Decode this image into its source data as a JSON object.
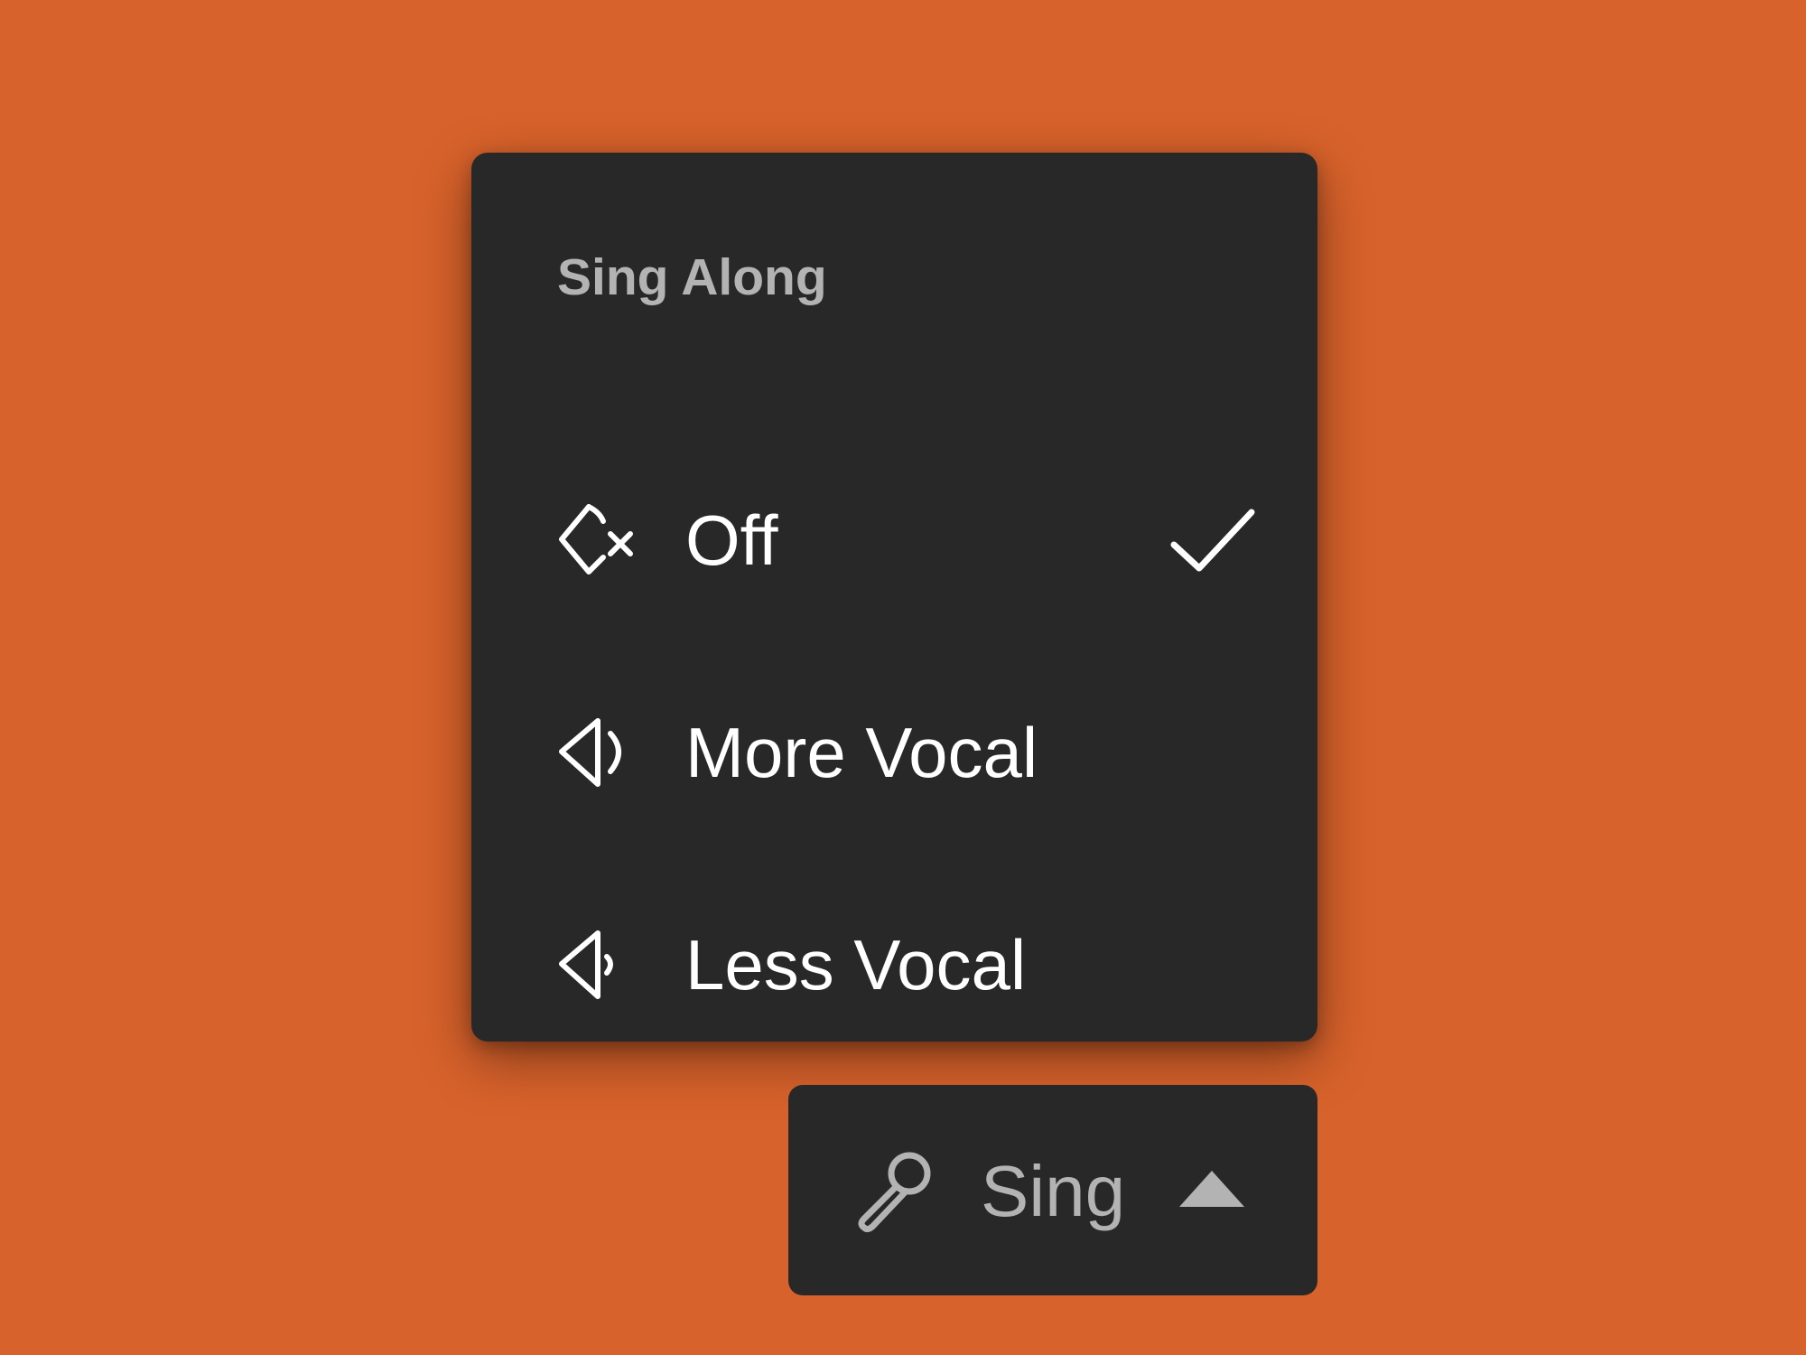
{
  "colors": {
    "background": "#D8622B",
    "panel": "#282828",
    "text_primary": "#FFFFFF",
    "text_secondary": "#B3B3B3"
  },
  "menu": {
    "title": "Sing Along",
    "selected": "Off",
    "items": [
      {
        "label": "Off",
        "icon": "speaker-muted-icon",
        "selected": true
      },
      {
        "label": "More Vocal",
        "icon": "speaker-louder-icon",
        "selected": false
      },
      {
        "label": "Less Vocal",
        "icon": "speaker-quieter-icon",
        "selected": false
      }
    ]
  },
  "button": {
    "label": "Sing",
    "icon": "microphone-icon",
    "caret": "caret-up-icon"
  }
}
